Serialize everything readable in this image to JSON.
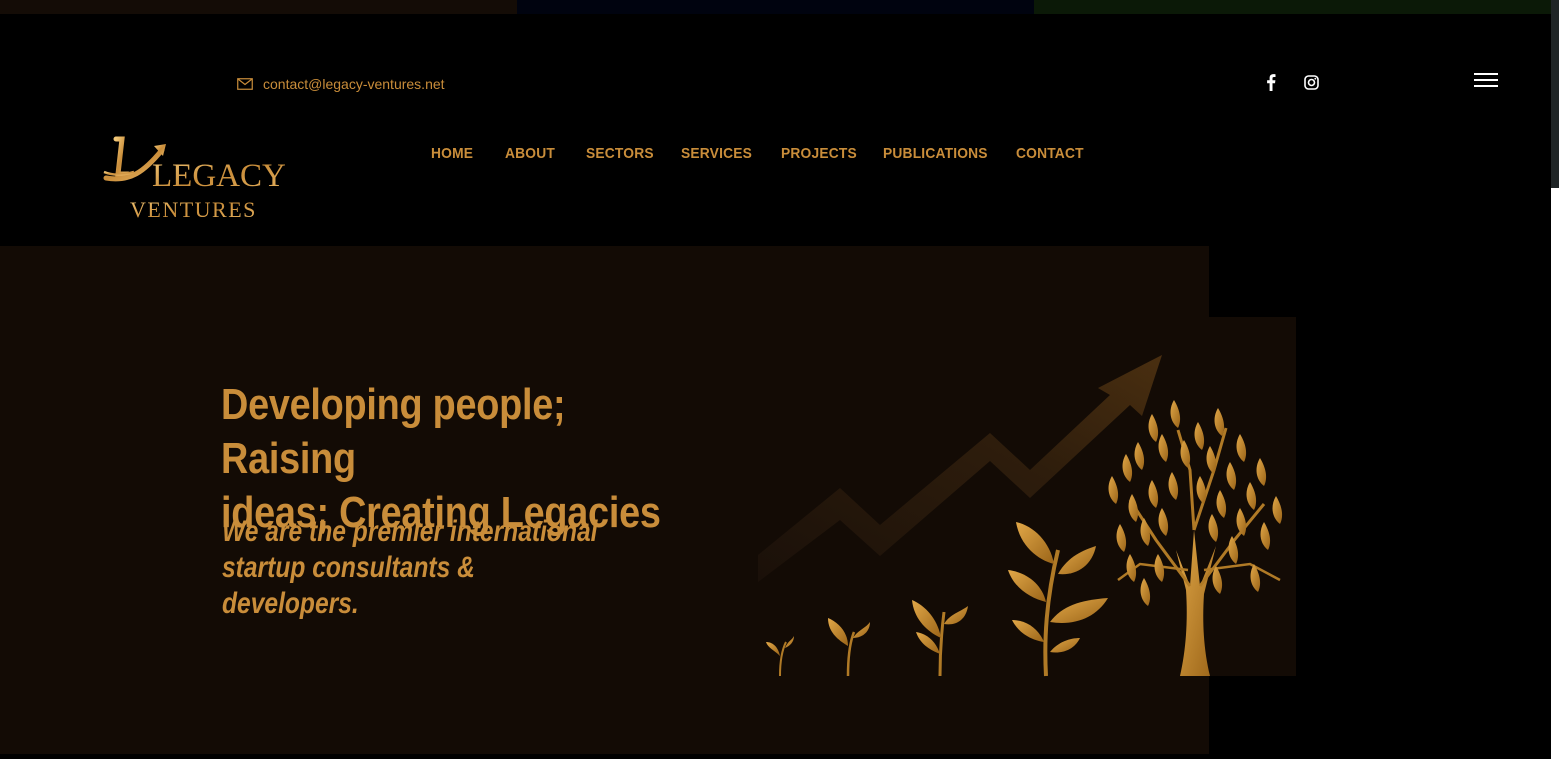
{
  "header": {
    "contact_email": "contact@legacy-ventures.net",
    "social": [
      {
        "icon": "facebook-icon"
      },
      {
        "icon": "instagram-icon"
      }
    ],
    "menu_icon": "hamburger-icon"
  },
  "logo": {
    "line1": "LEGACY",
    "line2": "VENTURES"
  },
  "nav": {
    "items": [
      {
        "label": "HOME"
      },
      {
        "label": "ABOUT"
      },
      {
        "label": "SECTORS"
      },
      {
        "label": "SERVICES"
      },
      {
        "label": "PROJECTS"
      },
      {
        "label": "PUBLICATIONS"
      },
      {
        "label": "CONTACT"
      }
    ]
  },
  "hero": {
    "headline_line1": "Developing people; Raising",
    "headline_line2": "ideas; Creating Legacies",
    "sub_line1": "We are the premier international",
    "sub_line2": "startup consultants & developers."
  },
  "colors": {
    "accent": "#c98d3a",
    "background": "#000000",
    "hero_background": "#130b05"
  }
}
